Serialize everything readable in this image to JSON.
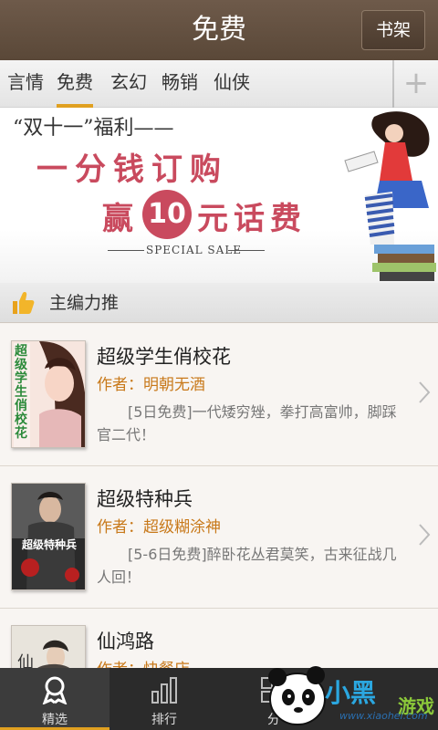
{
  "header": {
    "title": "免费",
    "shelf_button": "书架"
  },
  "tabs": {
    "items": [
      {
        "label": "言情"
      },
      {
        "label": "免费"
      },
      {
        "label": "玄幻"
      },
      {
        "label": "畅销"
      },
      {
        "label": "仙侠"
      }
    ],
    "active": "免费",
    "add_icon": "plus-icon"
  },
  "banner": {
    "line1": "“双十一”福利——",
    "line2": "一分钱订购",
    "line3_prefix": "赢",
    "line3_number": "10",
    "line3_suffix": "元话费",
    "tag": "SPECIAL SALE",
    "accent_color": "#c94a5e"
  },
  "section": {
    "title": "主编力推",
    "icon": "thumbs-up-icon"
  },
  "books": [
    {
      "title": "超级学生俏校花",
      "author": "作者：明朝无酒",
      "description": "[5日免费]一代矮穷矬，拳打高富帅，脚踩官二代！",
      "cover_text": "超级学生俏校花"
    },
    {
      "title": "超级特种兵",
      "author": "作者：超级糊涂神",
      "description": "[5-6日免费]醉卧花丛君莫笑，古来征战几人回！",
      "cover_text": "超级特种兵"
    },
    {
      "title": "仙鸿路",
      "author": "作者：快餐店",
      "description": "",
      "cover_text": "仙"
    }
  ],
  "bottom_nav": [
    {
      "label": "精选",
      "icon": "ribbon-icon",
      "active": true
    },
    {
      "label": "排行",
      "icon": "bar-chart-icon",
      "active": false
    },
    {
      "label": "分",
      "icon": "grid-icon",
      "active": false
    }
  ],
  "watermark": {
    "text": "小黑",
    "text2": "游戏",
    "url": "www.xiaohei.com"
  },
  "colors": {
    "header": "#5f4d3d",
    "accent": "#e0a020",
    "author": "#c8791a"
  }
}
